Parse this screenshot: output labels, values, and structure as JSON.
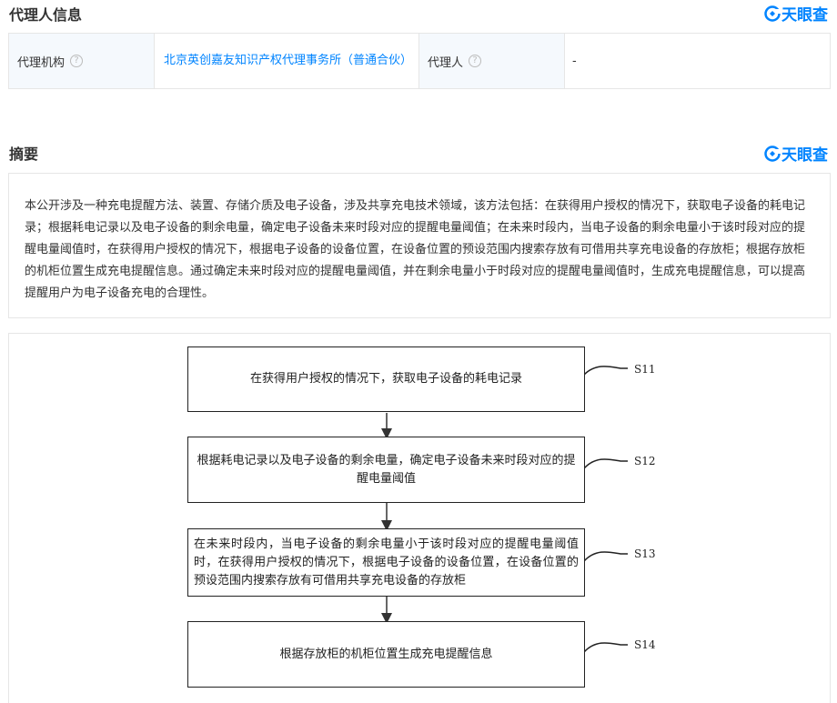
{
  "agent_section": {
    "title": "代理人信息",
    "logo_text": "天眼查",
    "agency_label": "代理机构",
    "agency_value": "北京英创嘉友知识产权代理事务所（普通合伙）",
    "agent_label": "代理人",
    "agent_value": "-",
    "help_glyph": "?"
  },
  "abstract_section": {
    "title": "摘要",
    "logo_text": "天眼查",
    "text": "本公开涉及一种充电提醒方法、装置、存储介质及电子设备，涉及共享充电技术领域，该方法包括：在获得用户授权的情况下，获取电子设备的耗电记录；根据耗电记录以及电子设备的剩余电量，确定电子设备未来时段对应的提醒电量阈值；在未来时段内，当电子设备的剩余电量小于该时段对应的提醒电量阈值时，在获得用户授权的情况下，根据电子设备的设备位置，在设备位置的预设范围内搜索存放有可借用共享充电设备的存放柜；根据存放柜的机柜位置生成充电提醒信息。通过确定未来时段对应的提醒电量阈值，并在剩余电量小于时段对应的提醒电量阈值时，生成充电提醒信息，可以提高提醒用户为电子设备充电的合理性。"
  },
  "flowchart": {
    "steps": [
      {
        "id": "S11",
        "text": "在获得用户授权的情况下，获取电子设备的耗电记录"
      },
      {
        "id": "S12",
        "text": "根据耗电记录以及电子设备的剩余电量，确定电子设备未来时段对应的提醒电量阈值"
      },
      {
        "id": "S13",
        "text": "在未来时段内，当电子设备的剩余电量小于该时段对应的提醒电量阈值时，在获得用户授权的情况下，根据电子设备的设备位置，在设备位置的预设范围内搜索存放有可借用共享充电设备的存放柜"
      },
      {
        "id": "S14",
        "text": "根据存放柜的机柜位置生成充电提醒信息"
      }
    ]
  },
  "colors": {
    "accent": "#0084ff",
    "label_bg": "#f5f9fd",
    "border": "#e6e6e6"
  }
}
